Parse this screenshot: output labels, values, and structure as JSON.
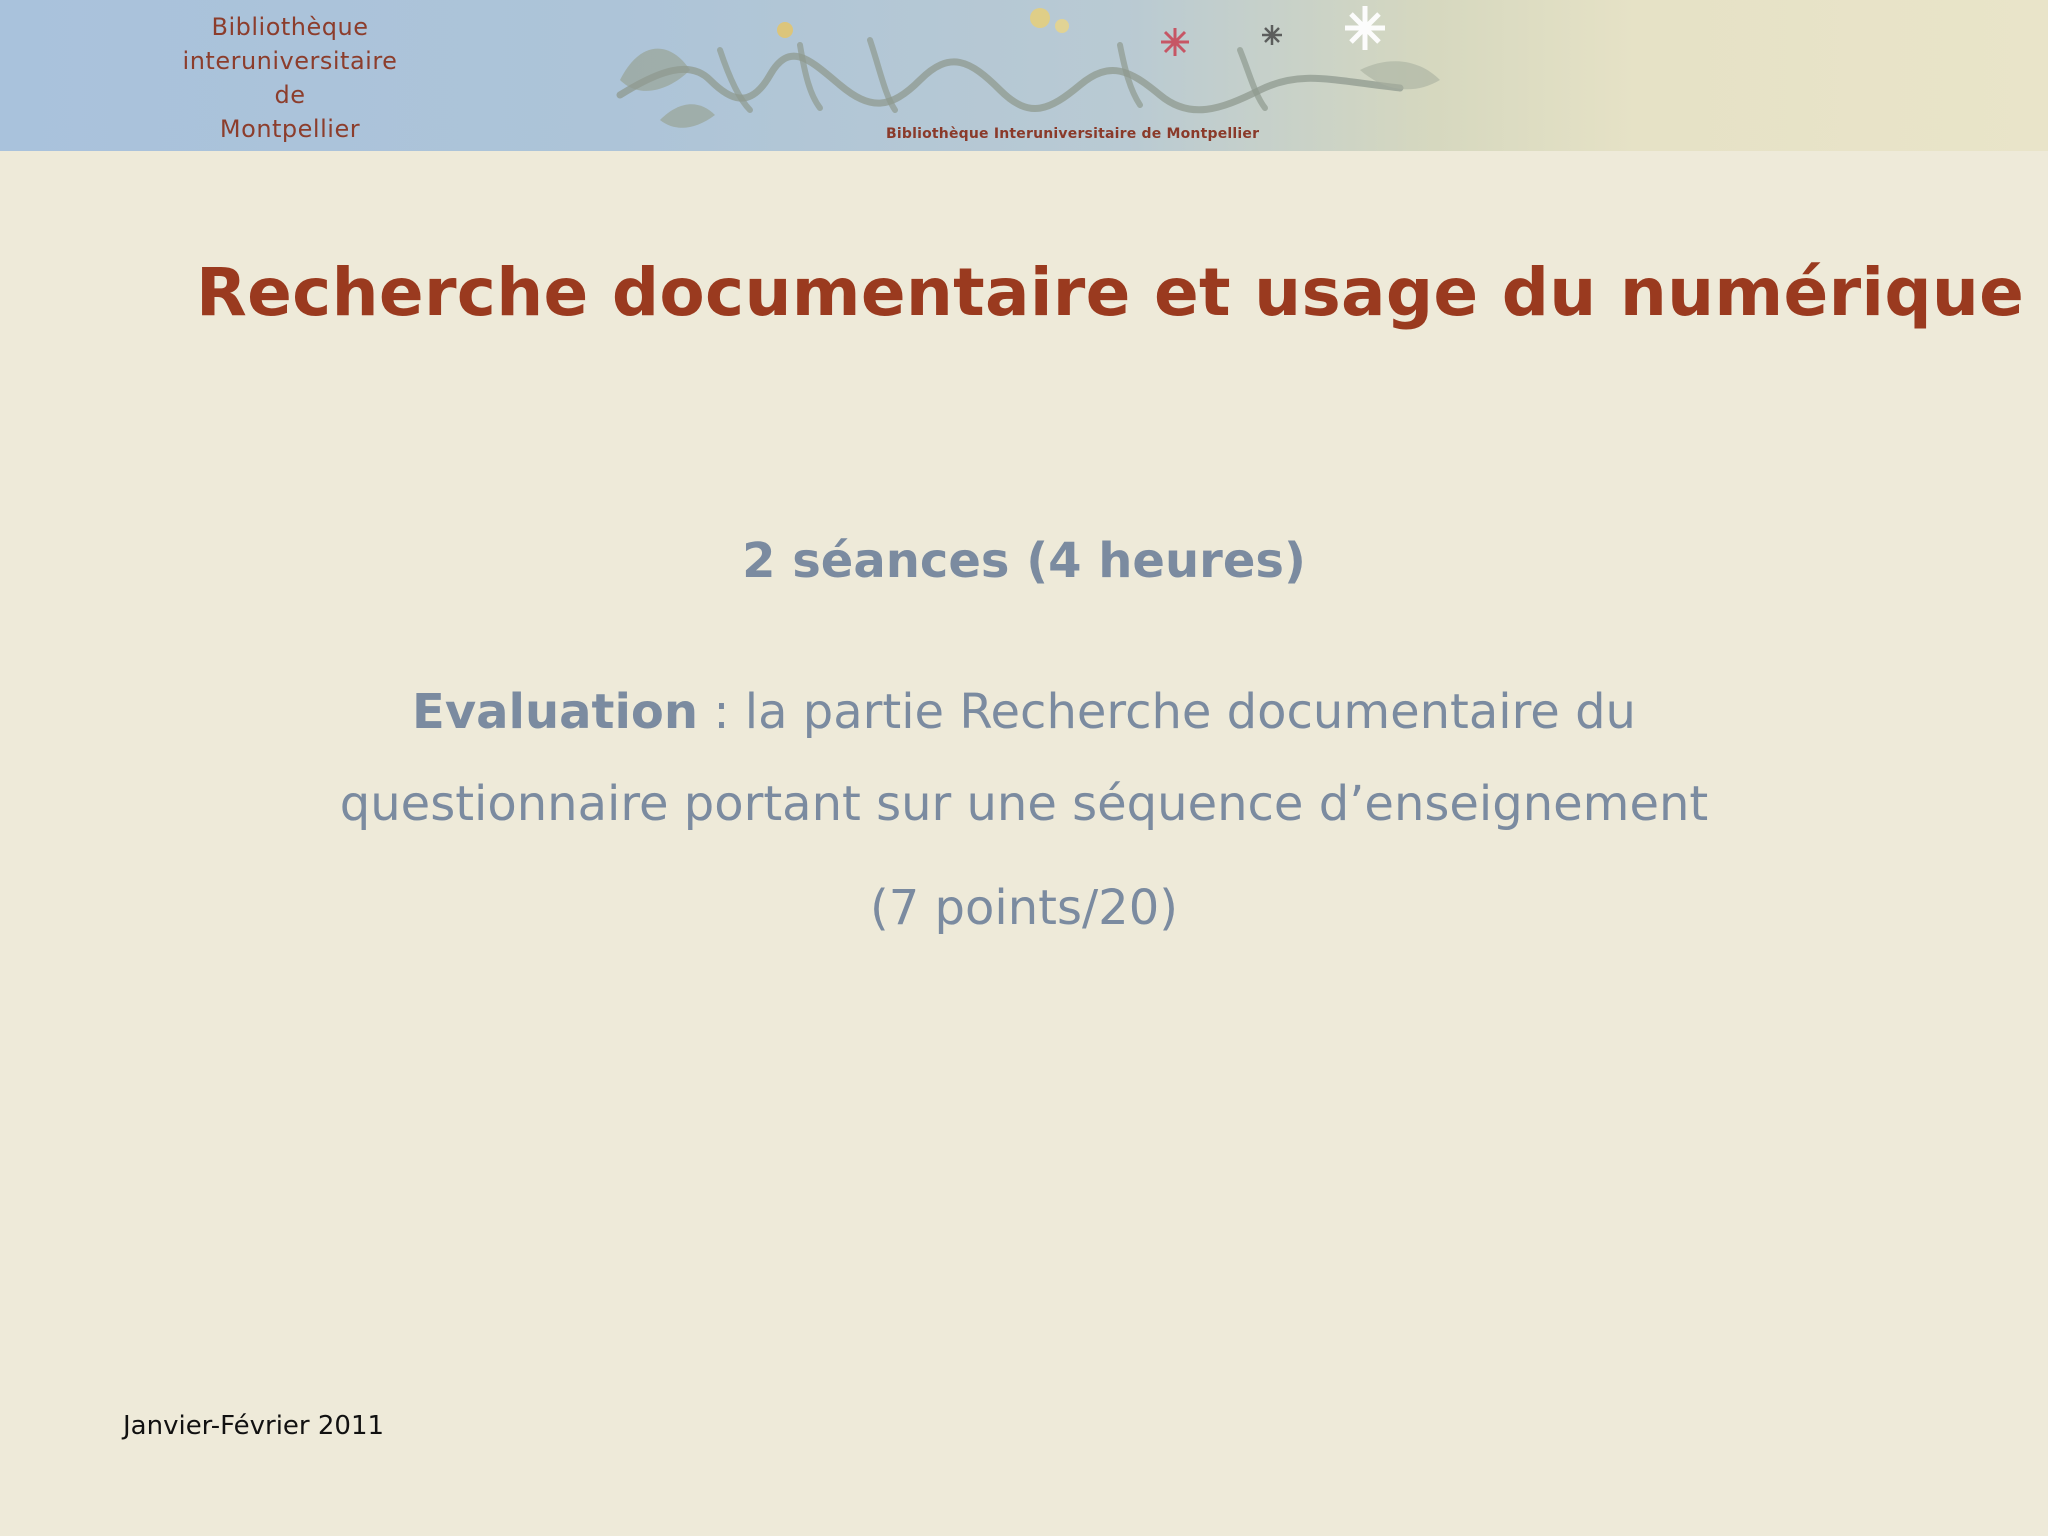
{
  "banner": {
    "library_name_lines": [
      "Bibliothèque",
      "interuniversitaire",
      "de",
      "Montpellier"
    ],
    "caption": "Bibliothèque Interuniversitaire de Montpellier"
  },
  "slide": {
    "title": "Recherche documentaire et usage du numérique",
    "sessions": "2 séances (4 heures)",
    "evaluation_label": "Evaluation",
    "evaluation_separator": " : ",
    "evaluation_text_line1": "la partie Recherche documentaire du",
    "evaluation_text_line2": "questionnaire portant sur une séquence d’enseignement",
    "evaluation_text_line3": "(7 points/20)"
  },
  "footer": {
    "date": "Janvier-Février 2011"
  },
  "colors": {
    "title": "#9a3a1f",
    "body_text": "#7b8ba0",
    "background": "#eeead9",
    "banner_text": "#8c3d2c"
  }
}
